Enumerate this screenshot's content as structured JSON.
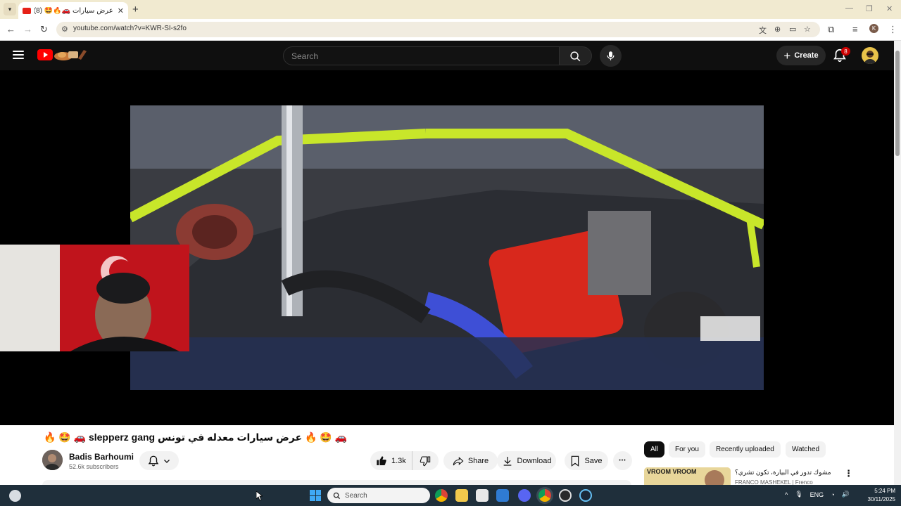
{
  "browser": {
    "tab_title": "عرض سيارات 🚗🔥🤩 (8)",
    "tab_close": "✕",
    "new_tab": "+",
    "url": "youtube.com/watch?v=KWR-SI-s2fo",
    "profile_initial": "K"
  },
  "header": {
    "search_placeholder": "Search",
    "create_label": "Create",
    "notification_count": "8"
  },
  "video": {
    "title": "🔥 🤩 🚗 slepperz gang عرض سيارات معدله في تونس 🔥 🤩 🚗",
    "channel_name": "Badis Barhoumi",
    "subscribers": "52.6k subscribers",
    "likes": "1.3k",
    "share_label": "Share",
    "download_label": "Download",
    "save_label": "Save",
    "more_label": "•••"
  },
  "chips": [
    "All",
    "For you",
    "Recently uploaded",
    "Watched"
  ],
  "recommendation": {
    "thumb_text": "VROOM VROOM",
    "title": "مشوك تدور في البيارة، تكون تشري؟",
    "channel": "FRANCO MASHEKEL | Frenco"
  },
  "taskbar": {
    "search_placeholder": "Search",
    "language": "ENG",
    "time": "5:24 PM",
    "date": "30/11/2025"
  },
  "colors": {
    "brand_red": "#ff0000",
    "header_bg": "#0f0f0f",
    "taskbar_bg": "#1f2f3b"
  }
}
